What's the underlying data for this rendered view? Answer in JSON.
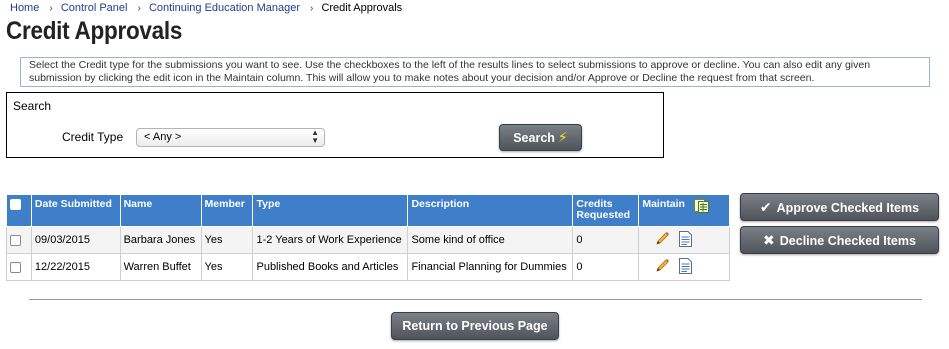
{
  "breadcrumb": {
    "items": [
      "Home",
      "Control Panel",
      "Continuing Education Manager"
    ],
    "current": "Credit Approvals",
    "separator": "›"
  },
  "page": {
    "title": "Credit Approvals"
  },
  "help_text": "Select the Credit type for the submissions you want to see. Use the checkboxes to the left of the results lines to select submissions to approve or decline. You can also edit any given submission by clicking the edit icon in the Maintain column. This will allow you to make notes about your decision and/or Approve or Decline the request from that screen.",
  "search": {
    "legend": "Search",
    "credit_type_label": "Credit Type",
    "credit_type_value": "< Any >",
    "button_label": "Search",
    "button_icon": "lightning-icon"
  },
  "table": {
    "headers": {
      "date": "Date Submitted",
      "name": "Name",
      "member": "Member",
      "type": "Type",
      "description": "Description",
      "credits": "Credits Requested",
      "maintain": "Maintain"
    },
    "rows": [
      {
        "date": "09/03/2015",
        "name": "Barbara Jones",
        "member": "Yes",
        "type": "1-2 Years of Work Experience",
        "description": "Some kind of office",
        "credits": "0"
      },
      {
        "date": "12/22/2015",
        "name": "Warren Buffet",
        "member": "Yes",
        "type": "Published Books and Articles",
        "description": "Financial Planning for Dummies",
        "credits": "0"
      }
    ]
  },
  "actions": {
    "approve_label": "Approve Checked Items",
    "decline_label": "Decline Checked Items",
    "return_label": "Return to Previous Page"
  },
  "colors": {
    "table_header": "#3f7fc9",
    "button_dark": "#5f646a",
    "link": "#1f3f8f",
    "search_bolt": "#f3e620"
  }
}
